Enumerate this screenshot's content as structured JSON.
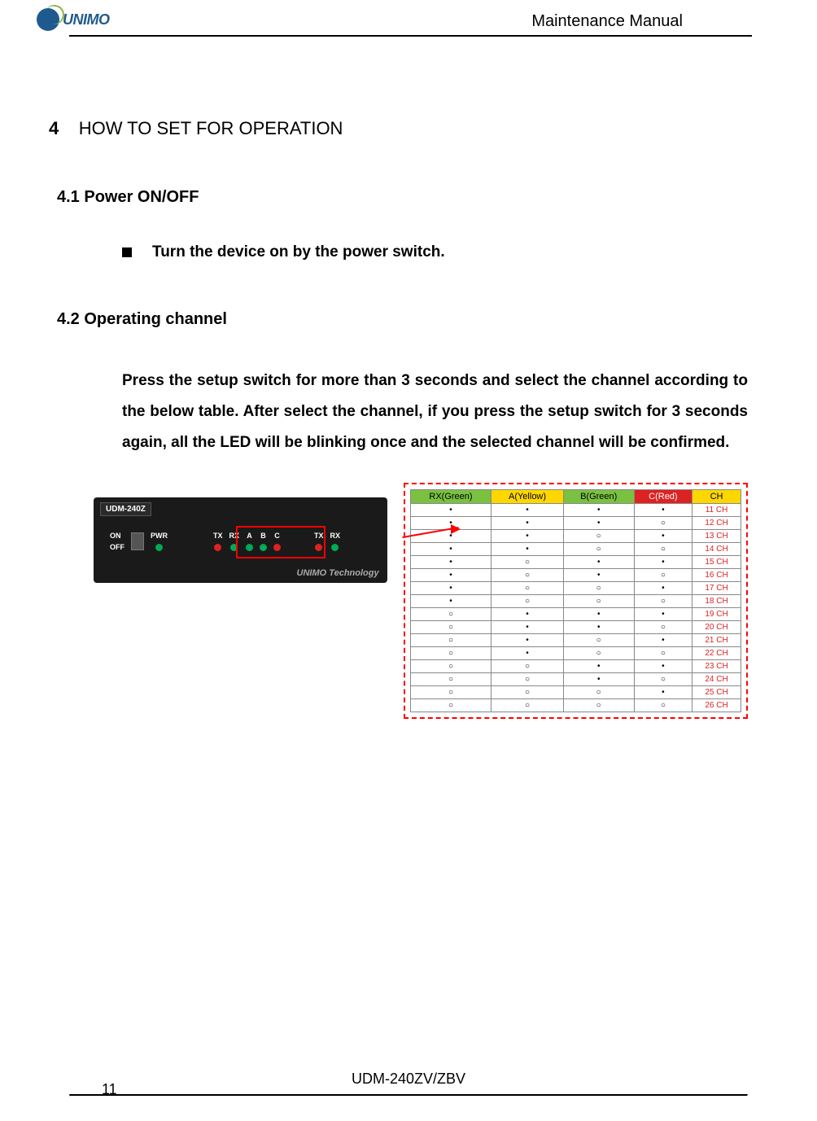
{
  "header": {
    "logo_text": "UNIMO",
    "doc_title": "Maintenance Manual"
  },
  "section": {
    "number": "4",
    "title": "HOW TO SET FOR OPERATION"
  },
  "sub_4_1": {
    "title": "4.1 Power ON/OFF",
    "bullet": "Turn the device on by the power switch."
  },
  "sub_4_2": {
    "title": "4.2 Operating channel",
    "paragraph": "Press the setup switch for more than 3 seconds and select the channel according to the below table. After select the channel, if you press the setup switch for 3 seconds again, all the LED will be blinking once and the selected channel will be confirmed."
  },
  "device": {
    "model": "UDM-240Z",
    "on": "ON",
    "off": "OFF",
    "pwr": "PWR",
    "tx": "TX",
    "rx": "RX",
    "a": "A",
    "b": "B",
    "c": "C",
    "brand": "UNIMO Technology"
  },
  "table": {
    "headers": {
      "rx": "RX(Green)",
      "a": "A(Yellow)",
      "b": "B(Green)",
      "c": "C(Red)",
      "ch": "CH"
    },
    "rows": [
      {
        "rx": "•",
        "a": "•",
        "b": "•",
        "c": "•",
        "ch": "11 CH"
      },
      {
        "rx": "•",
        "a": "•",
        "b": "•",
        "c": "○",
        "ch": "12 CH"
      },
      {
        "rx": "•",
        "a": "•",
        "b": "○",
        "c": "•",
        "ch": "13 CH"
      },
      {
        "rx": "•",
        "a": "•",
        "b": "○",
        "c": "○",
        "ch": "14 CH"
      },
      {
        "rx": "•",
        "a": "○",
        "b": "•",
        "c": "•",
        "ch": "15 CH"
      },
      {
        "rx": "•",
        "a": "○",
        "b": "•",
        "c": "○",
        "ch": "16 CH"
      },
      {
        "rx": "•",
        "a": "○",
        "b": "○",
        "c": "•",
        "ch": "17 CH"
      },
      {
        "rx": "•",
        "a": "○",
        "b": "○",
        "c": "○",
        "ch": "18 CH"
      },
      {
        "rx": "○",
        "a": "•",
        "b": "•",
        "c": "•",
        "ch": "19 CH"
      },
      {
        "rx": "○",
        "a": "•",
        "b": "•",
        "c": "○",
        "ch": "20 CH"
      },
      {
        "rx": "○",
        "a": "•",
        "b": "○",
        "c": "•",
        "ch": "21 CH"
      },
      {
        "rx": "○",
        "a": "•",
        "b": "○",
        "c": "○",
        "ch": "22 CH"
      },
      {
        "rx": "○",
        "a": "○",
        "b": "•",
        "c": "•",
        "ch": "23 CH"
      },
      {
        "rx": "○",
        "a": "○",
        "b": "•",
        "c": "○",
        "ch": "24 CH"
      },
      {
        "rx": "○",
        "a": "○",
        "b": "○",
        "c": "•",
        "ch": "25 CH"
      },
      {
        "rx": "○",
        "a": "○",
        "b": "○",
        "c": "○",
        "ch": "26 CH"
      }
    ]
  },
  "footer": {
    "model": "UDM-240ZV/ZBV",
    "page": "11"
  }
}
